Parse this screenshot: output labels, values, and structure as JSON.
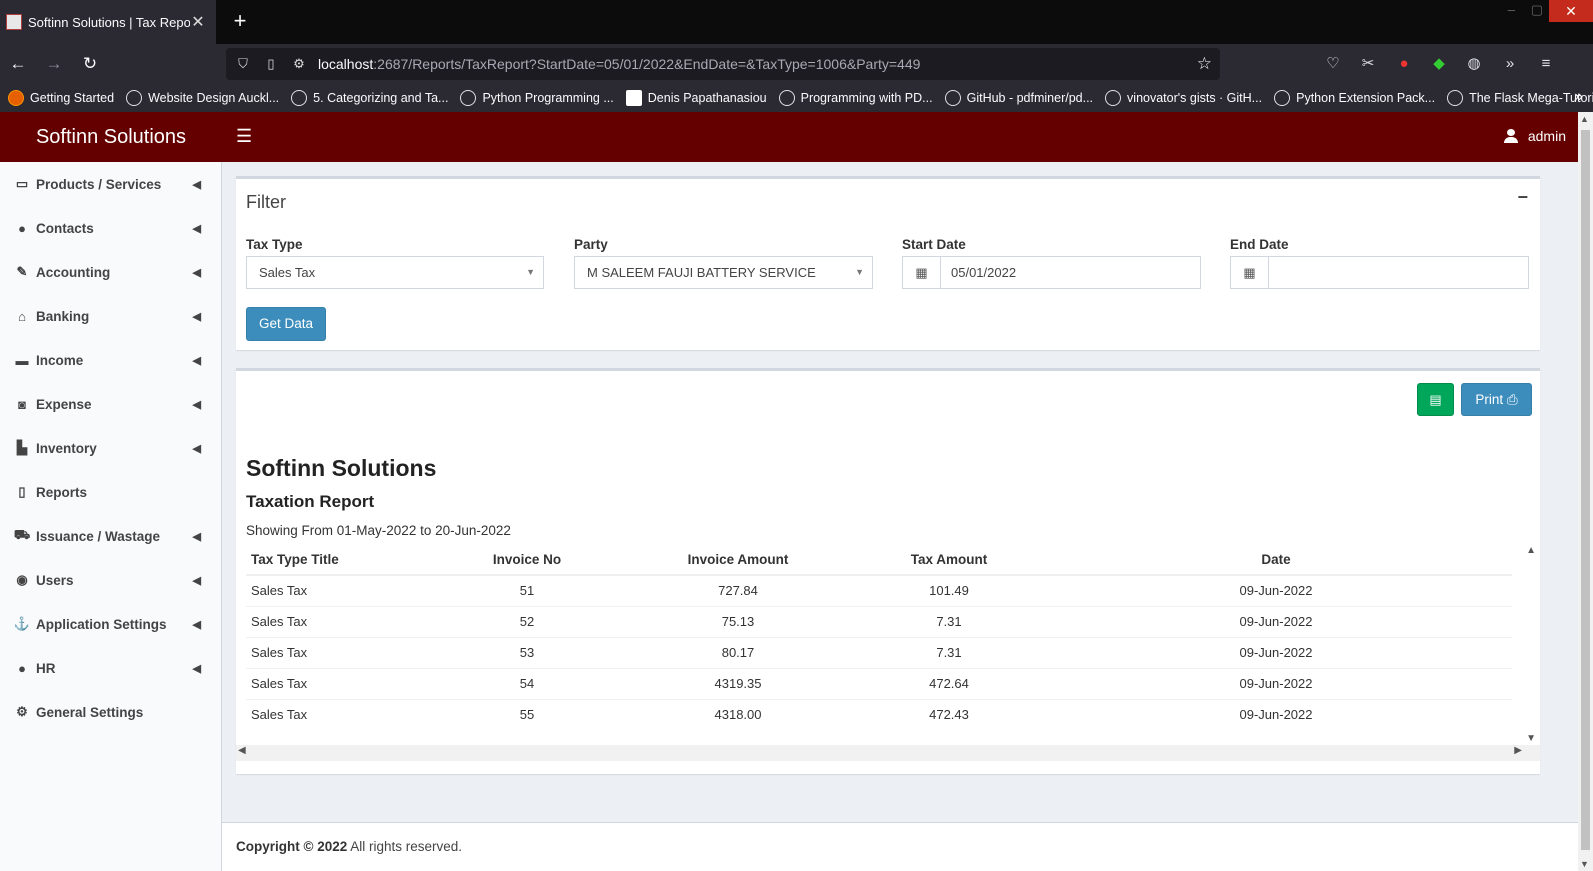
{
  "browser": {
    "tab_title": "Softinn Solutions | Tax Report",
    "url_host": "localhost",
    "url_path": ":2687/Reports/TaxReport?StartDate=05/01/2022&EndDate=&TaxType=1006&Party=449",
    "bookmarks": [
      "Getting Started",
      "Website Design Auckl...",
      "5. Categorizing and Ta...",
      "Python Programming ...",
      "Denis Papathanasiou",
      "Programming with PD...",
      "GitHub - pdfminer/pd...",
      "vinovator's gists · GitH...",
      "Python Extension Pack...",
      "The Flask Mega-Tutori..."
    ]
  },
  "header": {
    "logo": "Softinn Solutions",
    "user": "admin"
  },
  "sidebar": {
    "items": [
      {
        "label": "Products / Services",
        "icon": "laptop-icon"
      },
      {
        "label": "Contacts",
        "icon": "user-icon"
      },
      {
        "label": "Accounting",
        "icon": "edit-icon"
      },
      {
        "label": "Banking",
        "icon": "bank-icon"
      },
      {
        "label": "Income",
        "icon": "money-icon"
      },
      {
        "label": "Expense",
        "icon": "cash-icon"
      },
      {
        "label": "Inventory",
        "icon": "boxes-icon"
      },
      {
        "label": "Reports",
        "icon": "clipboard-icon"
      },
      {
        "label": "Issuance / Wastage",
        "icon": "cart-icon"
      },
      {
        "label": "Users",
        "icon": "user-circle-icon"
      },
      {
        "label": "Application Settings",
        "icon": "anchor-icon"
      },
      {
        "label": "HR",
        "icon": "user-icon"
      },
      {
        "label": "General Settings",
        "icon": "gear-icon"
      }
    ]
  },
  "filter": {
    "title": "Filter",
    "tax_type_label": "Tax Type",
    "tax_type_value": "Sales Tax",
    "party_label": "Party",
    "party_value": "M SALEEM FAUJI BATTERY SERVICE",
    "start_date_label": "Start Date",
    "start_date_value": "05/01/2022",
    "end_date_label": "End Date",
    "end_date_value": "",
    "get_data_label": "Get Data"
  },
  "report": {
    "print_label": "Print",
    "company": "Softinn Solutions",
    "title": "Taxation Report",
    "range": "Showing From 01-May-2022 to 20-Jun-2022",
    "columns": [
      "Tax Type Title",
      "Invoice No",
      "Invoice Amount",
      "Tax Amount",
      "Date"
    ],
    "rows": [
      [
        "Sales Tax",
        "51",
        "727.84",
        "101.49",
        "09-Jun-2022"
      ],
      [
        "Sales Tax",
        "52",
        "75.13",
        "7.31",
        "09-Jun-2022"
      ],
      [
        "Sales Tax",
        "53",
        "80.17",
        "7.31",
        "09-Jun-2022"
      ],
      [
        "Sales Tax",
        "54",
        "4319.35",
        "472.64",
        "09-Jun-2022"
      ],
      [
        "Sales Tax",
        "55",
        "4318.00",
        "472.43",
        "09-Jun-2022"
      ]
    ]
  },
  "footer": {
    "copyright": "Copyright © 2022",
    "rights": " All rights reserved."
  },
  "colors": {
    "header_bg": "#640000",
    "primary": "#3c8dbc",
    "success": "#00a65a"
  }
}
